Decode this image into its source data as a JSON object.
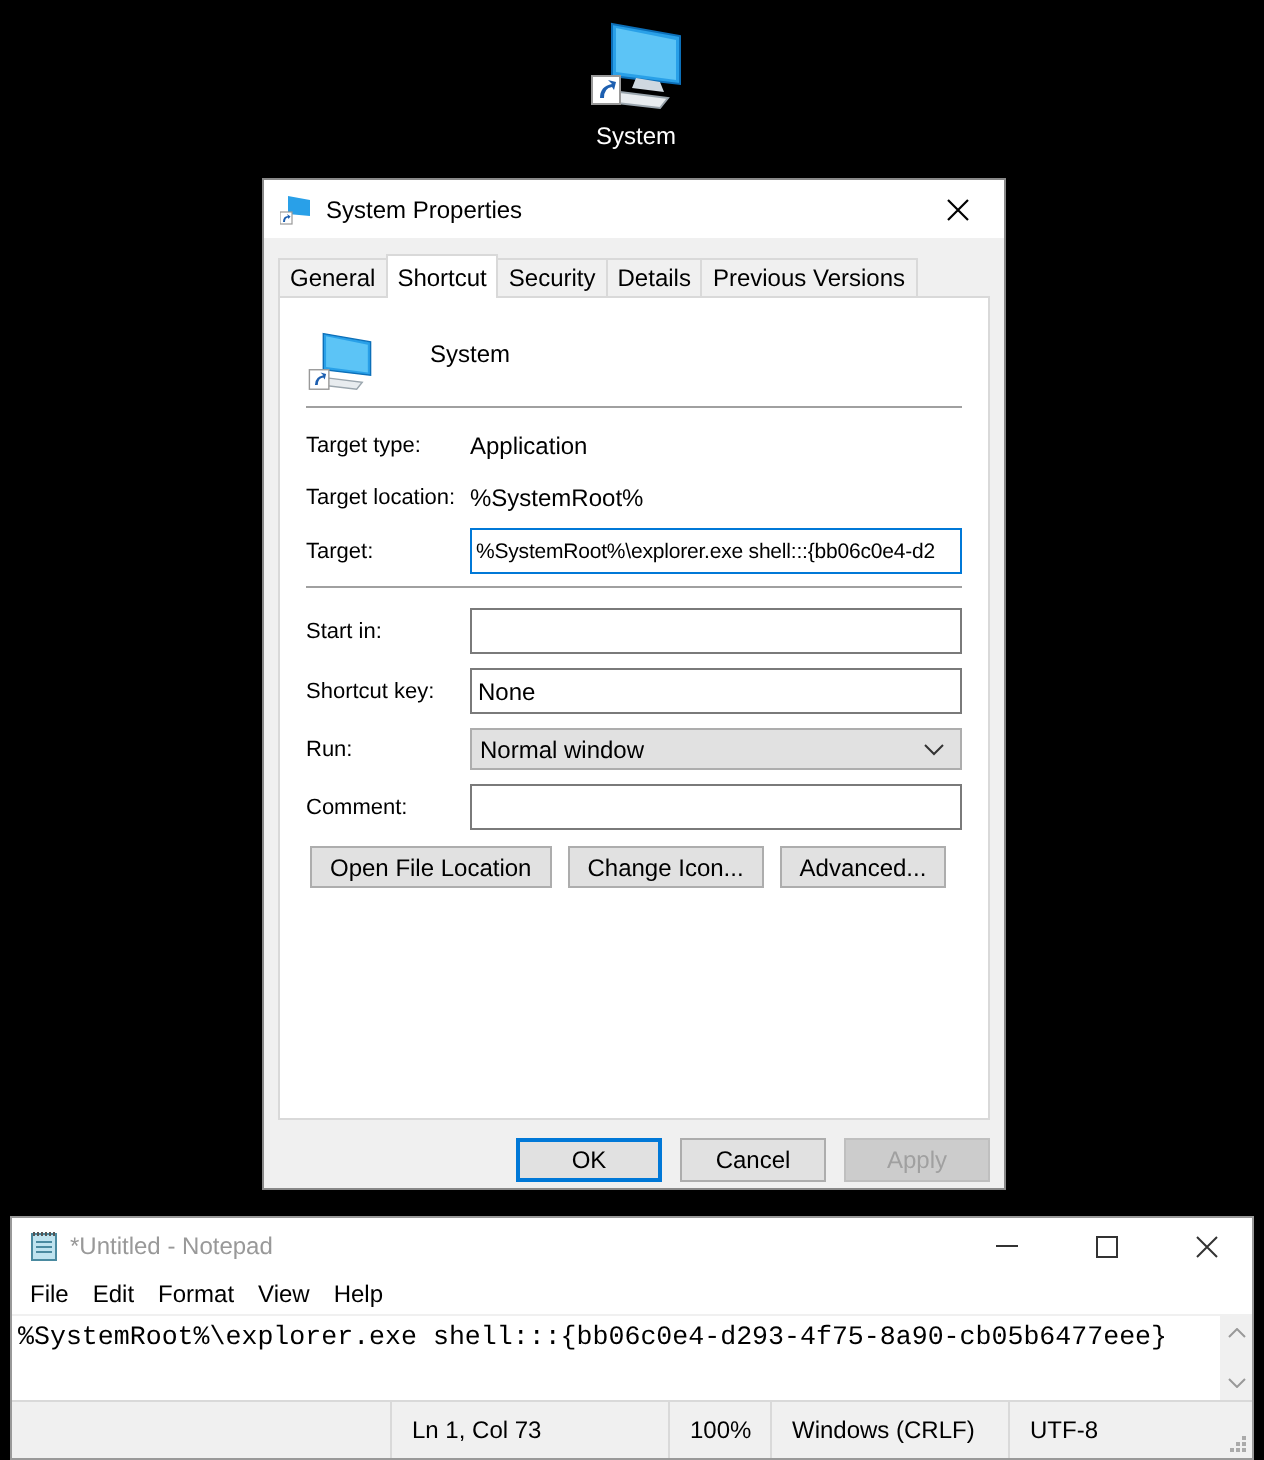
{
  "desktop_icon": {
    "label": "System"
  },
  "dialog": {
    "title": "System Properties",
    "tabs": [
      {
        "label": "General",
        "selected": false
      },
      {
        "label": "Shortcut",
        "selected": true
      },
      {
        "label": "Security",
        "selected": false
      },
      {
        "label": "Details",
        "selected": false
      },
      {
        "label": "Previous Versions",
        "selected": false
      }
    ],
    "shortcut_name": "System",
    "target_fields": [
      {
        "kind": "info",
        "label": "Target type:",
        "value": "Application"
      },
      {
        "kind": "info",
        "label": "Target location:",
        "value": "%SystemRoot%"
      },
      {
        "kind": "input",
        "label": "Target:",
        "value": "%SystemRoot%\\explorer.exe shell:::{bb06c0e4-d2",
        "focused": true
      }
    ],
    "launch_fields": [
      {
        "kind": "input",
        "label": "Start in:",
        "focused": false
      },
      {
        "kind": "input",
        "label": "Shortcut key:",
        "value": "None",
        "focused": false
      },
      {
        "kind": "select",
        "label": "Run:",
        "value": "Normal window"
      },
      {
        "kind": "input",
        "label": "Comment:",
        "focused": false
      }
    ],
    "actions": [
      "Open File Location",
      "Change Icon...",
      "Advanced..."
    ],
    "footer_buttons": [
      {
        "label": "OK",
        "default": true,
        "disabled": false
      },
      {
        "label": "Cancel",
        "default": false,
        "disabled": false
      },
      {
        "label": "Apply",
        "default": false,
        "disabled": true
      }
    ]
  },
  "notepad": {
    "title": "*Untitled - Notepad",
    "menu": [
      "File",
      "Edit",
      "Format",
      "View",
      "Help"
    ],
    "text": "%SystemRoot%\\explorer.exe shell:::{bb06c0e4-d293-4f75-8a90-cb05b6477eee}",
    "status_bar": [
      "Ln 1, Col 73",
      "100%",
      "Windows (CRLF)",
      "UTF-8"
    ]
  }
}
